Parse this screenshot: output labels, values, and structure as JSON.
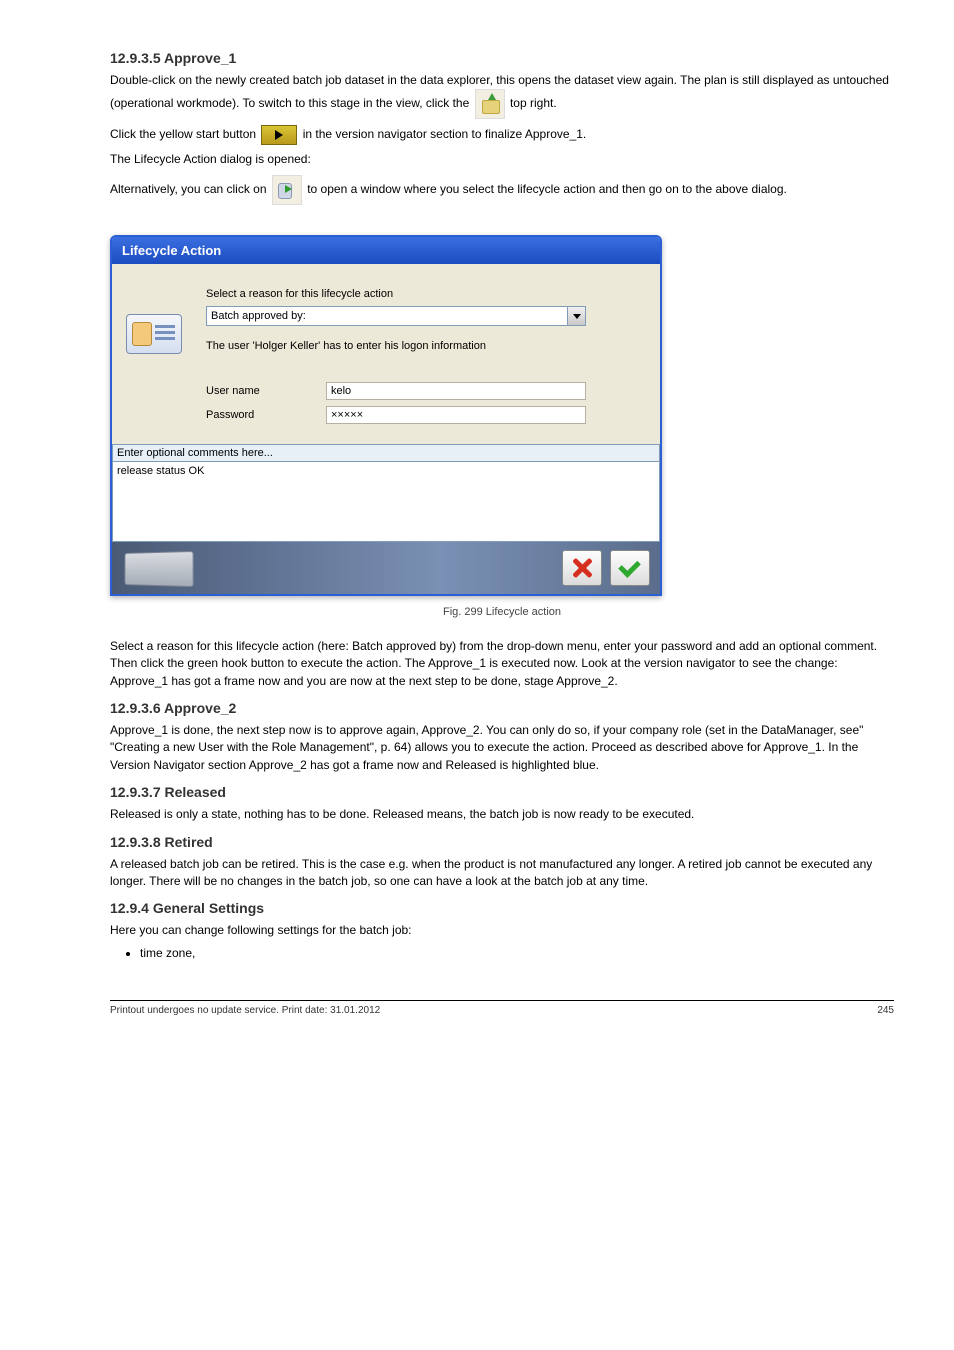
{
  "page": {
    "section_title": "12.9.3.5 Approve_1",
    "para1": "Double-click on the newly created batch job dataset in the data explorer, this opens the dataset view again. The plan is still displayed as untouched (operational workmode). To switch to this stage in the view, click the",
    "para1_end": "top right.",
    "para2_a": "Click the yellow start button",
    "para2_b": "in the version navigator section to finalize Approve_1.",
    "para3": "The Lifecycle Action dialog is opened:",
    "para4_a": "Alternatively, you can click on",
    "para4_b": "to open a window where you select the lifecycle action and then go on to the above dialog."
  },
  "dialog": {
    "title": "Lifecycle Action",
    "reason_label": "Select a reason for this lifecycle action",
    "reason_value": "Batch approved by:",
    "user_msg": "The user 'Holger Keller' has to enter his logon information",
    "username_label": "User name",
    "username_value": "kelo",
    "password_label": "Password",
    "password_value": "×××××",
    "comment_header": "Enter optional comments here...",
    "comment_value": "release status OK"
  },
  "figure_caption": "Fig. 299 Lifecycle action",
  "after": {
    "p1": "Select a reason for this lifecycle action (here: Batch approved by) from the drop-down menu, enter your password and add an optional comment. Then click the green hook button to execute the action. The Approve_1 is executed now. Look at the version navigator to see the change: Approve_1 has got a frame now and you are now at the next step to be done, stage Approve_2.",
    "h1": "12.9.3.6 Approve_2",
    "p2": "Approve_1 is done, the next step now is to approve again, Approve_2. You can only do so, if your company role (set in the DataManager, see\" \"Creating a new User with the Role Management\", p. 64) allows you to execute the action. Proceed as described above for Approve_1. In the Version Navigator section Approve_2 has got a frame now and Released is highlighted blue.",
    "h2": "12.9.3.7 Released",
    "p3": "Released is only a state, nothing has to be done. Released means, the batch job is now ready to be executed.",
    "h3": "12.9.3.8 Retired",
    "p4": "A released batch job can be retired. This is the case e.g. when the product is not manufactured any longer. A retired job cannot be executed any longer. There will be no changes in the batch job, so one can have a look at the batch job at any time.",
    "h4": "12.9.4 General Settings",
    "p5": "Here you can change following settings for the batch job:",
    "bullets": [
      "time zone,"
    ]
  },
  "footer": {
    "left": "Printout undergoes no update service. Print date: 31.01.2012",
    "right": "245"
  }
}
